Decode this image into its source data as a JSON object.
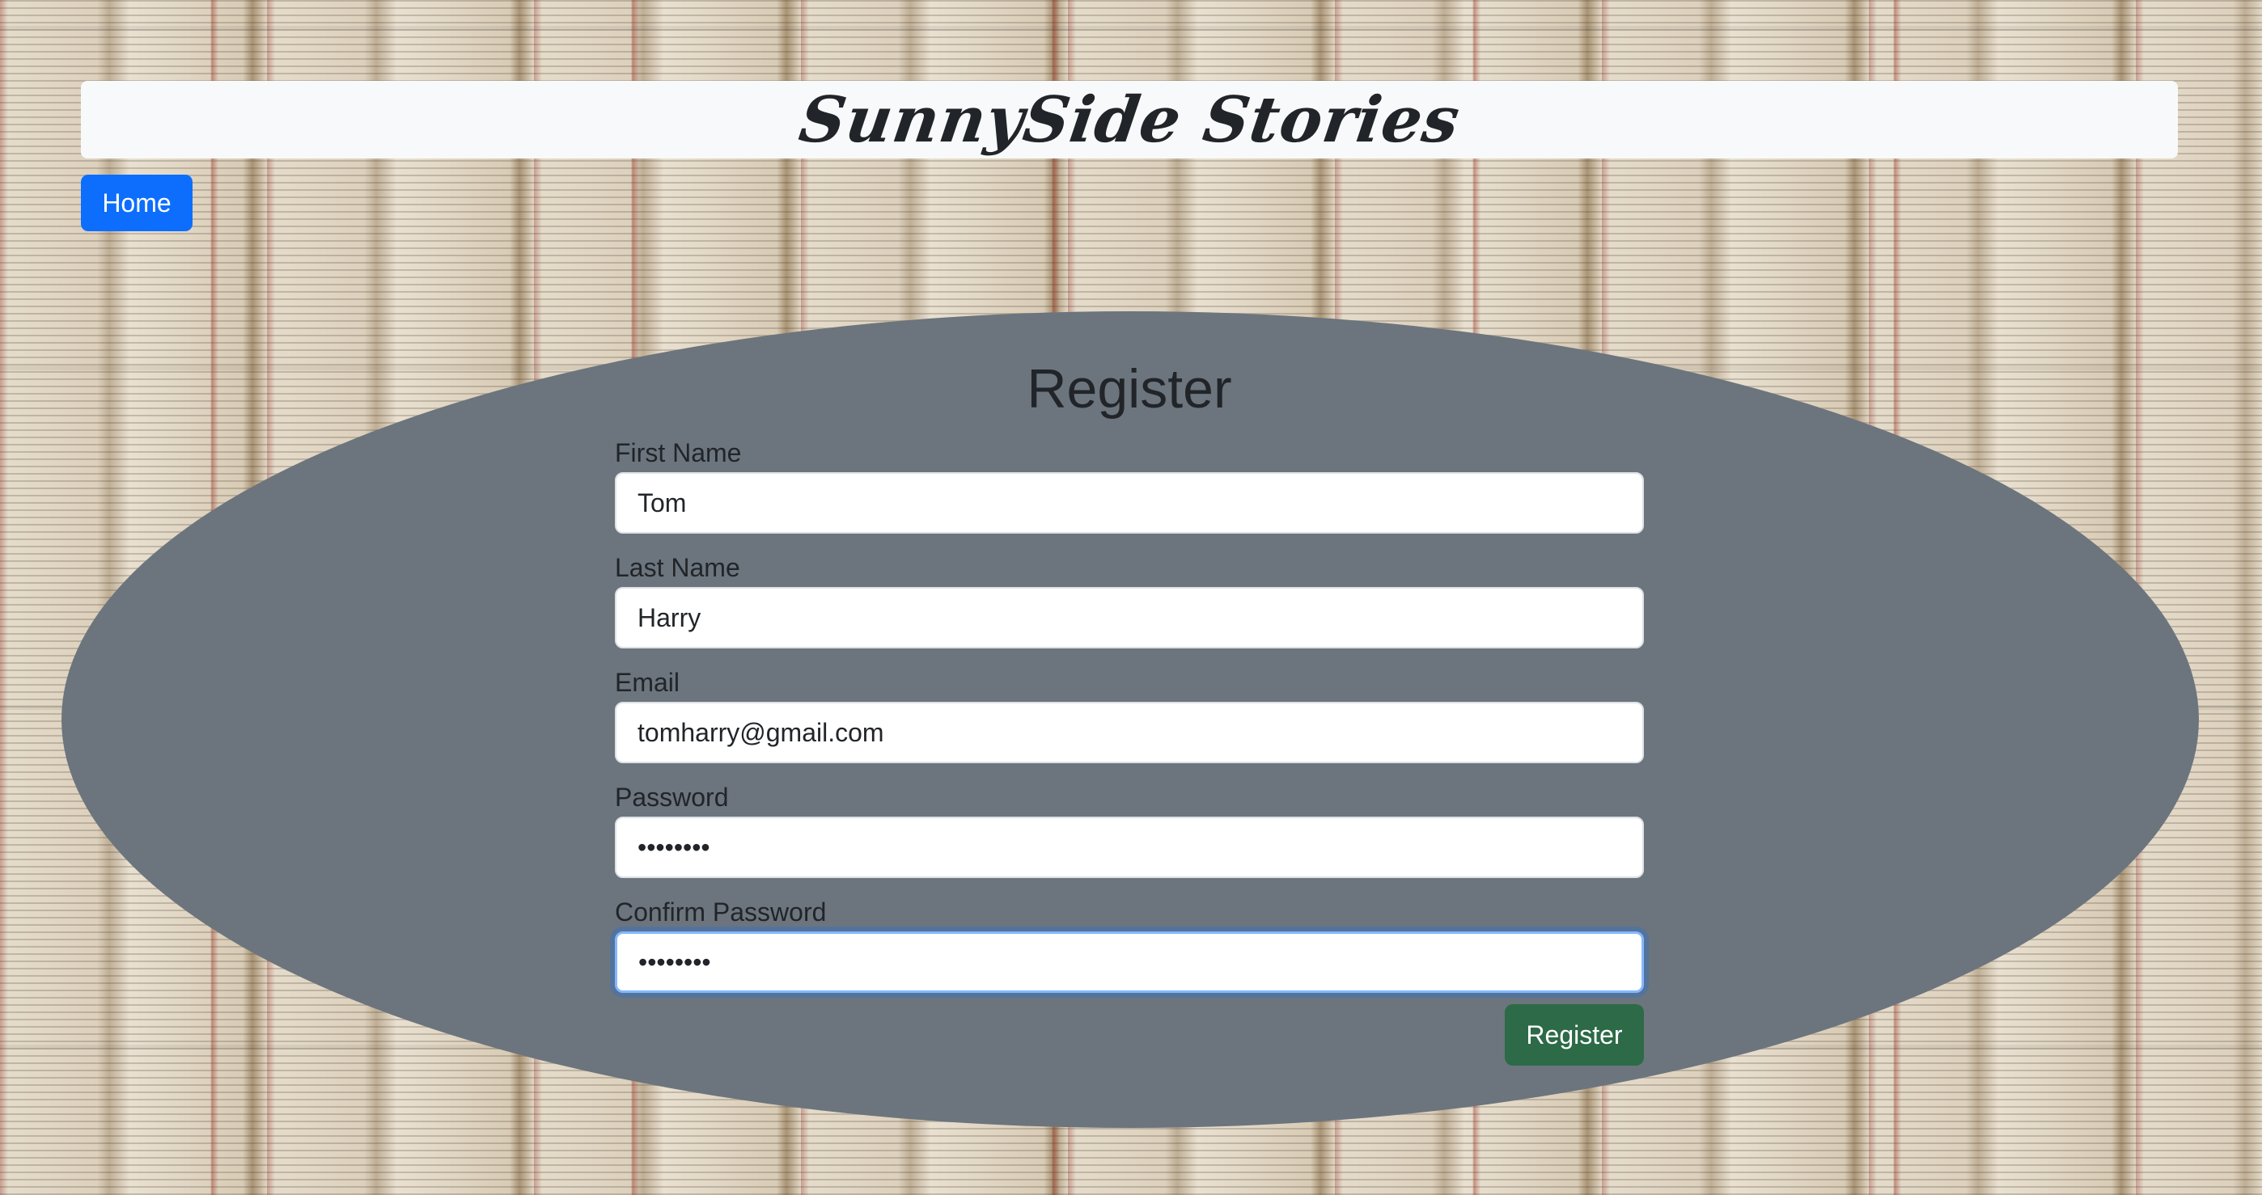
{
  "header": {
    "title": "SunnySide Stories"
  },
  "nav": {
    "home_label": "Home"
  },
  "form": {
    "title": "Register",
    "fields": [
      {
        "label": "First Name",
        "value": "Tom",
        "type": "text"
      },
      {
        "label": "Last Name",
        "value": "Harry",
        "type": "text"
      },
      {
        "label": "Email",
        "value": "tomharry@gmail.com",
        "type": "email"
      },
      {
        "label": "Password",
        "value": "••••••••",
        "type": "password"
      },
      {
        "label": "Confirm Password",
        "value": "••••••••",
        "type": "password"
      }
    ],
    "submit_label": "Register"
  },
  "colors": {
    "primary_button": "#0d6efd",
    "success_button": "#2d6a47",
    "form_background": "#6c757d",
    "header_background": "#f8f9fa"
  }
}
